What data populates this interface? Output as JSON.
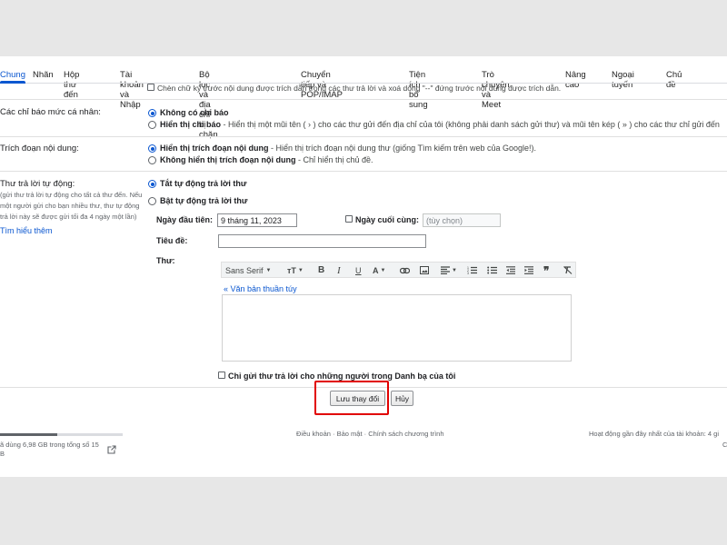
{
  "tabs": [
    "Chung",
    "Nhãn",
    "Hộp thư đến",
    "Tài khoản và Nhập",
    "Bộ lọc và địa chỉ bị chặn",
    "Chuyển tiếp và POP/IMAP",
    "Tiện ích bổ sung",
    "Trò chuyện và Meet",
    "Nâng cao",
    "Ngoại tuyến",
    "Chủ đề"
  ],
  "cut_top_option": "Chèn chữ ký trước nội dung được trích dẫn trong các thư trả lời và xoá dòng \"--\" đứng trước nội dung được trích dẫn.",
  "indicators": {
    "label": "Các chỉ báo mức cá nhân:",
    "opt1": "Không có chỉ báo",
    "opt2_bold": "Hiển thị chỉ báo",
    "opt2_desc": " - Hiển thị một mũi tên ( › ) cho các thư gửi đến địa chỉ của tôi (không phải danh sách gửi thư) và mũi tên kép ( » ) cho các thư chỉ gửi đến"
  },
  "snippets": {
    "label": "Trích đoạn nội dung:",
    "opt1_bold": "Hiển thị trích đoạn nội dung",
    "opt1_desc": " - Hiển thị trích đoạn nội dung thư (giống Tìm kiếm trên web của Google!).",
    "opt2_bold": "Không hiển thị trích đoạn nội dung",
    "opt2_desc": " - Chỉ hiển thị chủ đề."
  },
  "vacation": {
    "label": "Thư trả lời tự động:",
    "help_lines": [
      "(gửi thư trả lời tự động cho tất cả thư đến. Nếu",
      "một người gửi cho bạn nhiều thư, thư tự động",
      "trả lời này sẽ được gửi tối đa 4 ngày một lần)"
    ],
    "learn_more": "Tìm hiểu thêm",
    "off": "Tắt tự động trả lời thư",
    "on": "Bật tự động trả lời thư",
    "first_day_label": "Ngày đầu tiên:",
    "first_day_value": "9 tháng 11, 2023",
    "last_day_label": "Ngày cuối cùng:",
    "last_day_placeholder": "(tùy chọn)",
    "subject_label": "Tiêu đề:",
    "message_label": "Thư:",
    "font": "Sans Serif",
    "plain_text": "« Văn bản thuần túy",
    "contacts_only": "Chỉ gửi thư trả lời cho những người trong Danh bạ của tôi"
  },
  "buttons": {
    "save": "Lưu thay đổi",
    "cancel": "Hủy"
  },
  "footer": {
    "storage_line1": "ã dùng 6,98 GB trong tổng số 15",
    "storage_line2": "B",
    "storage_fraction": 0.465,
    "links": "Điều khoản · Bảo mật · Chính sách chương trình",
    "activity": "Hoạt động gần đây nhất của tài khoản: 4 gi",
    "activity2": "C"
  },
  "colors": {
    "accent": "#0b57d0",
    "highlight": "#e10000"
  }
}
